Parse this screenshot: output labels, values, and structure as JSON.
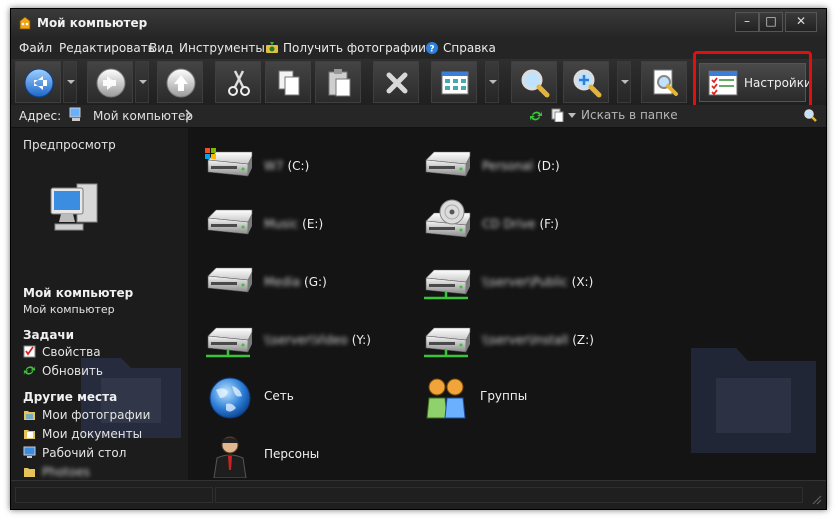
{
  "window": {
    "title": "Мой компьютер"
  },
  "menu": [
    "Файл",
    "Редактировать",
    "Вид",
    "Инструменты",
    "Получить фотографии",
    "Справка"
  ],
  "toolbar": {
    "settings_label": "Настройки"
  },
  "address": {
    "label": "Адрес:",
    "value": "Мой компьютер",
    "search_placeholder": "Искать в папке"
  },
  "sidebar": {
    "preview_label": "Предпросмотр",
    "selection_title": "Мой компьютер",
    "selection_subtitle": "Мой компьютер",
    "tasks_title": "Задачи",
    "tasks": [
      "Свойства",
      "Обновить"
    ],
    "places_title": "Другие места",
    "places": [
      "Мои фотографии",
      "Мои документы",
      "Рабочий стол",
      "Photoes"
    ]
  },
  "drives": [
    {
      "name": "W7",
      "letter": "(C:)",
      "icon": "system-drive-icon"
    },
    {
      "name": "Personal",
      "letter": "(D:)",
      "icon": "hard-drive-icon"
    },
    {
      "name": "Music",
      "letter": "(E:)",
      "icon": "hard-drive-icon"
    },
    {
      "name": "CD Drive",
      "letter": "(F:)",
      "icon": "cd-drive-icon"
    },
    {
      "name": "Media",
      "letter": "(G:)",
      "icon": "hard-drive-icon"
    },
    {
      "name": "\\\\server\\Public",
      "letter": "(X:)",
      "icon": "network-drive-icon"
    },
    {
      "name": "\\\\server\\Video",
      "letter": "(Y:)",
      "icon": "network-drive-icon"
    },
    {
      "name": "\\\\server\\Install",
      "letter": "(Z:)",
      "icon": "network-drive-icon"
    }
  ],
  "items": [
    {
      "label": "Сеть",
      "icon": "network-globe-icon"
    },
    {
      "label": "Группы",
      "icon": "groups-icon"
    },
    {
      "label": "Персоны",
      "icon": "person-icon"
    }
  ],
  "colors": {
    "highlight": "#e01010",
    "window_bg": "#1c1c1c"
  }
}
